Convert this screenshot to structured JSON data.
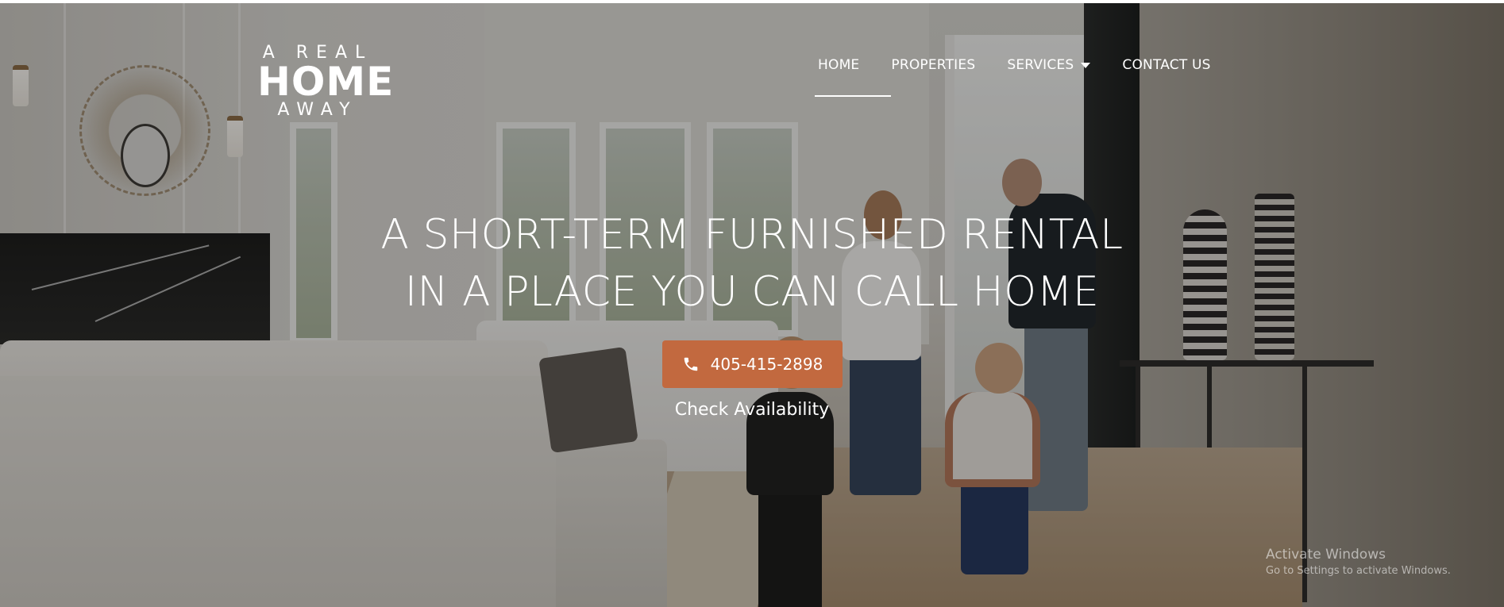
{
  "logo": {
    "line1": "A REAL",
    "line2": "HOME",
    "line3": "AWAY"
  },
  "nav": {
    "items": [
      {
        "label": "HOME",
        "active": true
      },
      {
        "label": "PROPERTIES"
      },
      {
        "label": "SERVICES",
        "has_dropdown": true
      },
      {
        "label": "CONTACT US"
      }
    ]
  },
  "hero": {
    "headline_line1": "A SHORT-TERM FURNISHED RENTAL",
    "headline_line2": "IN A PLACE YOU CAN CALL HOME",
    "phone_button": {
      "label": "405-415-2898",
      "icon": "phone-icon",
      "color": "#c2693f"
    },
    "check_availability": "Check Availability"
  },
  "watermark": {
    "title": "Activate Windows",
    "subtitle": "Go to Settings to activate Windows."
  }
}
